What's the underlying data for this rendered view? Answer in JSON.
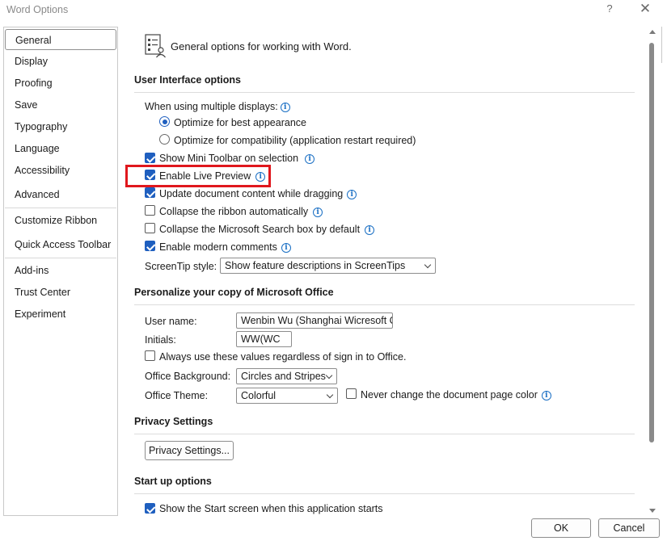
{
  "window": {
    "title": "Word Options",
    "help_label": "?",
    "close_label": "✕"
  },
  "nav": {
    "items": [
      {
        "label": "General",
        "selected": true
      },
      {
        "label": "Display"
      },
      {
        "label": "Proofing"
      },
      {
        "label": "Save"
      },
      {
        "label": "Typography"
      },
      {
        "label": "Language"
      },
      {
        "label": "Accessibility"
      },
      {
        "label": "Advanced"
      },
      {
        "label": "Customize Ribbon"
      },
      {
        "label": "Quick Access Toolbar"
      },
      {
        "label": "Add-ins"
      },
      {
        "label": "Trust Center"
      },
      {
        "label": "Experiment"
      }
    ]
  },
  "header": {
    "text": "General options for working with Word."
  },
  "ui_options": {
    "section_title": "User Interface options",
    "multi_display_label": "When using multiple displays:",
    "radio_best": "Optimize for best appearance",
    "radio_compat": "Optimize for compatibility (application restart required)",
    "mini_toolbar": "Show Mini Toolbar on selection",
    "live_preview": "Enable Live Preview",
    "update_dragging": "Update document content while dragging",
    "collapse_ribbon": "Collapse the ribbon automatically",
    "collapse_search": "Collapse the Microsoft Search box by default",
    "modern_comments": "Enable modern comments",
    "screentip_label": "ScreenTip style:",
    "screentip_value": "Show feature descriptions in ScreenTips"
  },
  "personalize": {
    "section_title": "Personalize your copy of Microsoft Office",
    "user_name_label": "User name:",
    "user_name_value": "Wenbin Wu (Shanghai Wicresoft Co",
    "initials_label": "Initials:",
    "initials_value": "WW(WC",
    "always_use": "Always use these values regardless of sign in to Office.",
    "background_label": "Office Background:",
    "background_value": "Circles and Stripes",
    "theme_label": "Office Theme:",
    "theme_value": "Colorful",
    "never_change": "Never change the document page color"
  },
  "privacy": {
    "section_title": "Privacy Settings",
    "button_label": "Privacy Settings..."
  },
  "startup": {
    "section_title": "Start up options",
    "show_start": "Show the Start screen when this application starts"
  },
  "footer": {
    "ok_label": "OK",
    "cancel_label": "Cancel"
  },
  "info_glyph": "i",
  "colors": {
    "accent": "#1f5fbf",
    "highlight": "#e0171d",
    "info": "#1a6fc4"
  }
}
